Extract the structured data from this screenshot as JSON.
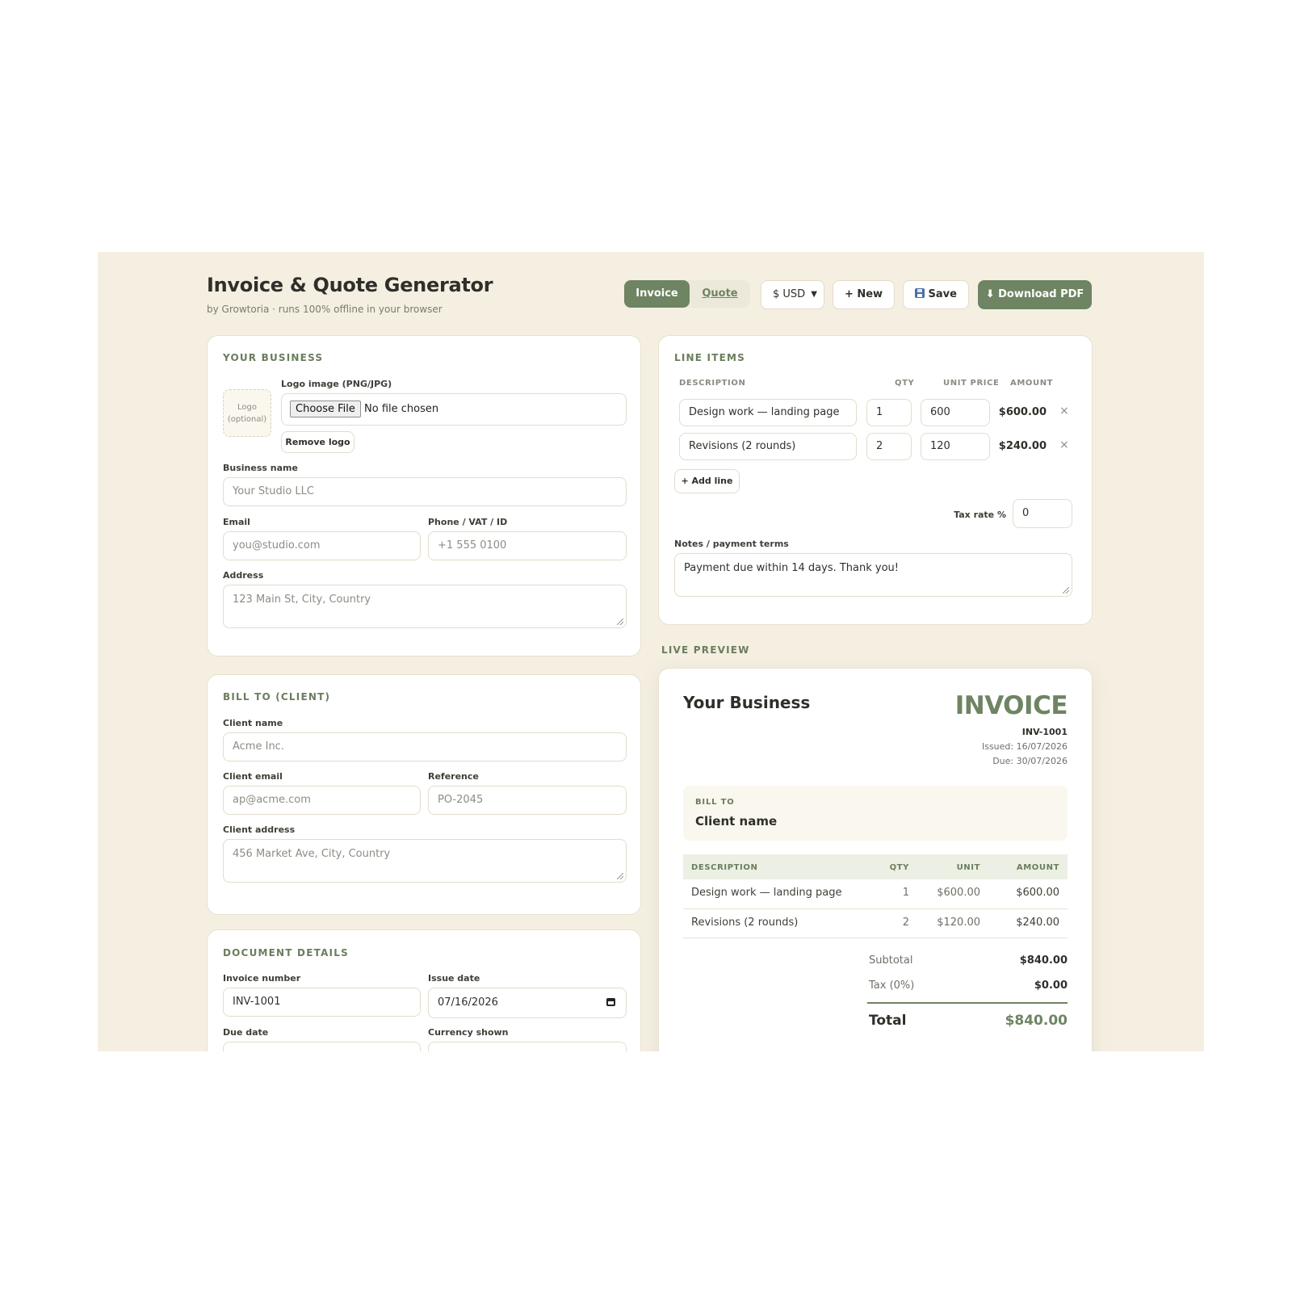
{
  "header": {
    "title": "Invoice & Quote Generator",
    "subtitle": "by Growtoria · runs 100% offline in your browser",
    "mode_invoice": "Invoice",
    "mode_quote": "Quote",
    "currency": "$ USD",
    "new_label": "+ New",
    "save_label": "Save",
    "download_label": "Download PDF"
  },
  "business": {
    "section": "YOUR BUSINESS",
    "logo_placeholder_1": "Logo",
    "logo_placeholder_2": "(optional)",
    "logo_label": "Logo image (PNG/JPG)",
    "choose_file": "Choose File",
    "no_file": "No file chosen",
    "remove_logo": "Remove logo",
    "name_label": "Business name",
    "name_placeholder": "Your Studio LLC",
    "email_label": "Email",
    "email_placeholder": "you@studio.com",
    "phone_label": "Phone / VAT / ID",
    "phone_placeholder": "+1 555 0100",
    "address_label": "Address",
    "address_placeholder": "123 Main St, City, Country"
  },
  "client": {
    "section": "BILL TO (CLIENT)",
    "name_label": "Client name",
    "name_placeholder": "Acme Inc.",
    "email_label": "Client email",
    "email_placeholder": "ap@acme.com",
    "ref_label": "Reference",
    "ref_placeholder": "PO-2045",
    "address_label": "Client address",
    "address_placeholder": "456 Market Ave, City, Country"
  },
  "document": {
    "section": "DOCUMENT DETAILS",
    "number_label": "Invoice number",
    "number_value": "INV-1001",
    "issue_label": "Issue date",
    "issue_value": "07/16/2026",
    "due_label": "Due date",
    "currency_label": "Currency shown"
  },
  "line_items": {
    "section": "LINE ITEMS",
    "col_desc": "DESCRIPTION",
    "col_qty": "QTY",
    "col_price": "UNIT PRICE",
    "col_amount": "AMOUNT",
    "rows": [
      {
        "desc": "Design work — landing page",
        "qty": "1",
        "price": "600",
        "amount": "$600.00"
      },
      {
        "desc": "Revisions (2 rounds)",
        "qty": "2",
        "price": "120",
        "amount": "$240.00"
      }
    ],
    "remove_glyph": "×",
    "add_line": "+ Add line",
    "tax_label": "Tax rate %",
    "tax_value": "0",
    "notes_label": "Notes / payment terms",
    "notes_value": "Payment due within 14 days. Thank you!"
  },
  "preview": {
    "section": "LIVE PREVIEW",
    "business_name": "Your Business",
    "doc_type": "INVOICE",
    "number": "INV-1001",
    "issued": "Issued: 16/07/2026",
    "due": "Due: 30/07/2026",
    "bill_to_label": "BILL TO",
    "client_name": "Client name",
    "col_desc": "DESCRIPTION",
    "col_qty": "QTY",
    "col_unit": "UNIT",
    "col_amount": "AMOUNT",
    "rows": [
      {
        "desc": "Design work — landing page",
        "qty": "1",
        "unit": "$600.00",
        "amount": "$600.00"
      },
      {
        "desc": "Revisions (2 rounds)",
        "qty": "2",
        "unit": "$120.00",
        "amount": "$240.00"
      }
    ],
    "subtotal_label": "Subtotal",
    "subtotal_value": "$840.00",
    "tax_label": "Tax (0%)",
    "tax_value": "$0.00",
    "total_label": "Total",
    "total_value": "$840.00"
  },
  "colors": {
    "accent": "#6e8462",
    "background": "#f4efe1",
    "card": "#ffffff"
  }
}
